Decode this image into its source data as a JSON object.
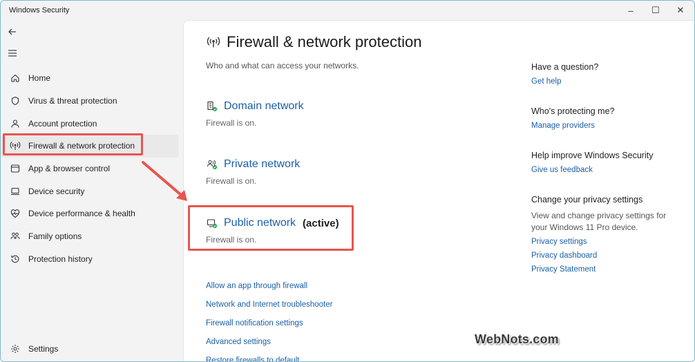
{
  "app": {
    "title": "Windows Security"
  },
  "window_controls": {
    "minimize": "–",
    "maximize": "☐",
    "close": "✕"
  },
  "nav": {
    "back_icon": "back-arrow-icon",
    "menu_icon": "hamburger-icon",
    "items": [
      {
        "label": "Home",
        "icon": "home-icon"
      },
      {
        "label": "Virus & threat protection",
        "icon": "shield-icon"
      },
      {
        "label": "Account protection",
        "icon": "person-icon"
      },
      {
        "label": "Firewall & network protection",
        "icon": "broadcast-icon",
        "active": true
      },
      {
        "label": "App & browser control",
        "icon": "browser-window-icon"
      },
      {
        "label": "Device security",
        "icon": "laptop-icon"
      },
      {
        "label": "Device performance & health",
        "icon": "heart-pulse-icon"
      },
      {
        "label": "Family options",
        "icon": "family-icon"
      },
      {
        "label": "Protection history",
        "icon": "history-icon"
      }
    ],
    "settings": {
      "label": "Settings",
      "icon": "gear-icon"
    }
  },
  "page": {
    "title": "Firewall & network protection",
    "subtitle": "Who and what can access your networks."
  },
  "networks": [
    {
      "name": "Domain network",
      "status": "Firewall is on.",
      "active_label": ""
    },
    {
      "name": "Private network",
      "status": "Firewall is on.",
      "active_label": ""
    },
    {
      "name": "Public network",
      "status": "Firewall is on.",
      "active_label": "(active)"
    }
  ],
  "links": [
    "Allow an app through firewall",
    "Network and Internet troubleshooter",
    "Firewall notification settings",
    "Advanced settings",
    "Restore firewalls to default"
  ],
  "sidebar_right": {
    "question": {
      "heading": "Have a question?",
      "link": "Get help"
    },
    "protecting": {
      "heading": "Who's protecting me?",
      "link": "Manage providers"
    },
    "improve": {
      "heading": "Help improve Windows Security",
      "link": "Give us feedback"
    },
    "privacy": {
      "heading": "Change your privacy settings",
      "text": "View and change privacy settings for your Windows 11 Pro device.",
      "links": [
        "Privacy settings",
        "Privacy dashboard",
        "Privacy Statement"
      ]
    }
  },
  "watermark": {
    "text": "WebNots.com"
  },
  "colors": {
    "accent_link": "#1a5fa8",
    "highlight_red": "#e8554e",
    "status_green": "#16a34a"
  }
}
